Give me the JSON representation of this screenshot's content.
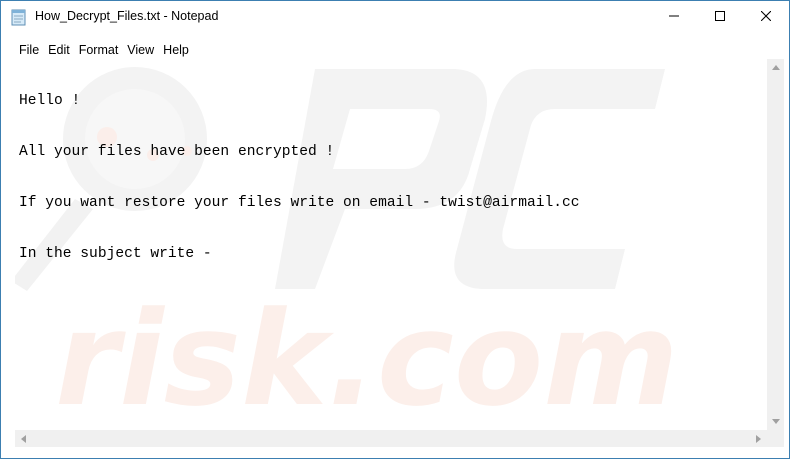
{
  "window": {
    "title": "How_Decrypt_Files.txt - Notepad",
    "icon": "notepad-icon",
    "controls": [
      "minimize-icon",
      "maximize-icon",
      "close-icon"
    ]
  },
  "menu": {
    "items": [
      {
        "label": "File"
      },
      {
        "label": "Edit"
      },
      {
        "label": "Format"
      },
      {
        "label": "View"
      },
      {
        "label": "Help"
      }
    ]
  },
  "editor": {
    "lines": [
      "Hello !",
      "All your files have been encrypted !",
      "If you want restore your files write on email - twist@airmail.cc",
      "In the subject write -"
    ]
  },
  "colors": {
    "window_border": "#3c7fb1",
    "scrollbar_track": "#f0f0f0",
    "watermark": "#f2f2f2"
  }
}
